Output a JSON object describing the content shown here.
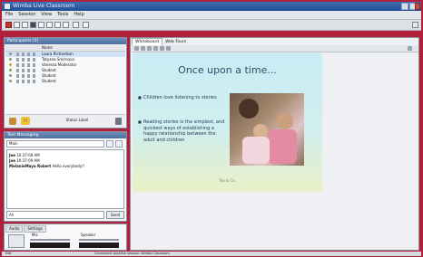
{
  "window": {
    "title": "Wimba Live Classroom",
    "controls": [
      "minimize-icon",
      "maximize-icon",
      "close-icon"
    ]
  },
  "menu": {
    "items": [
      "File",
      "Session",
      "View",
      "Tools",
      "Help"
    ]
  },
  "toolbar": {
    "buttons": [
      "record-icon",
      "play-icon",
      "stop-icon",
      "grid-icon",
      "presentation-icon",
      "whiteboard-icon",
      "screen-icon",
      "layout-icon",
      "help-icon"
    ]
  },
  "participants": {
    "header": "Participants (5)",
    "column_label": "Name",
    "list": [
      {
        "name": "Laura Richardson",
        "status": "green",
        "selected": true
      },
      {
        "name": "Tatyana Smirnova",
        "status": "green",
        "selected": false
      },
      {
        "name": "Vanessa Moderator",
        "status": "yellow",
        "selected": false
      },
      {
        "name": "Student",
        "status": "green",
        "selected": false
      },
      {
        "name": "Student",
        "status": "green",
        "selected": false
      },
      {
        "name": "Student",
        "status": "green",
        "selected": false
      }
    ],
    "status_text": "Status Label",
    "emote_label": "?!!"
  },
  "chat": {
    "header": "Text Messaging",
    "room": "Main",
    "messages": [
      {
        "who": "Joe",
        "time": "10:37:08 AM",
        "text": ""
      },
      {
        "who": "Joe",
        "time": "10:37:09 AM",
        "text": ""
      },
      {
        "who": "MelanieMayo Robert",
        "time": "",
        "text": "Hello everybody!!"
      }
    ],
    "input_placeholder": "All",
    "send_label": "Send"
  },
  "audio": {
    "tabs": [
      "Audio",
      "Settings"
    ],
    "mic_label": "Mic",
    "speaker_label": "Speaker",
    "mic_level": 0.1,
    "speaker_level": 0.2
  },
  "whiteboard": {
    "tabs": [
      "Whiteboard",
      "Web Tours"
    ],
    "slide": {
      "title": "Once upon a time...",
      "bullets": [
        "Children love listening to stories",
        "Reading stories is the simplest, and quickest ways of establishing a happy relationship between the adult and children"
      ],
      "footer": "Tea & Co."
    }
  },
  "status": {
    "left": "Edit",
    "right": "Connected: pipeline session: Wimba Classroom"
  }
}
